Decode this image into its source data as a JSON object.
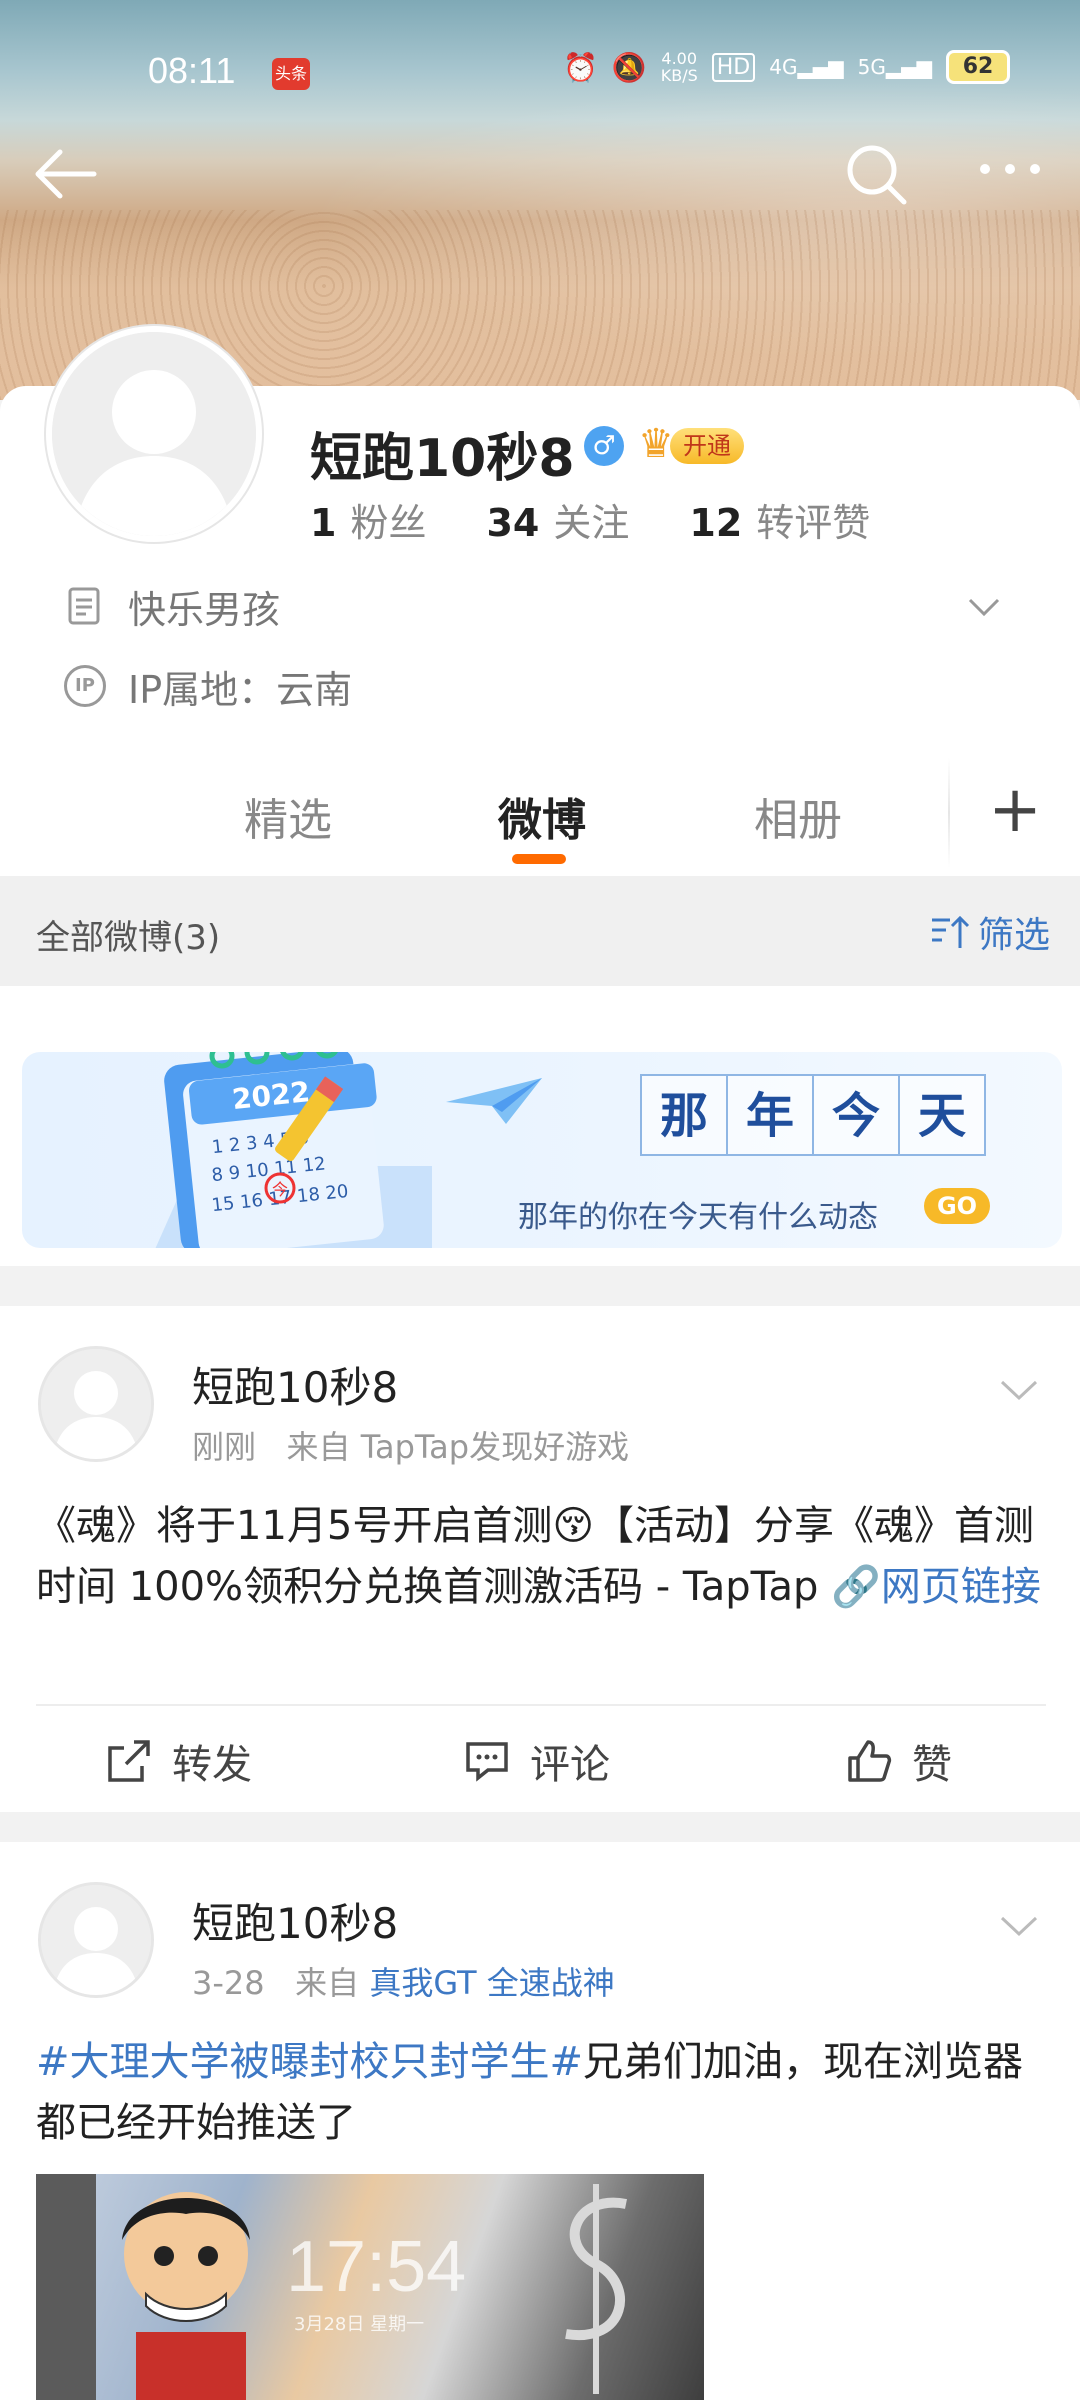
{
  "status_bar": {
    "time": "08:11",
    "news_badge": "头条",
    "net_speed_value": "4.00",
    "net_speed_unit": "KB/S",
    "hd_label": "HD",
    "signal1_label": "4G",
    "signal2_label": "5G",
    "battery": "62"
  },
  "profile": {
    "username": "短跑10秒8",
    "gender_symbol": "♂",
    "vip_label": "开通",
    "stats": [
      {
        "count": "1",
        "label": "粉丝"
      },
      {
        "count": "34",
        "label": "关注"
      },
      {
        "count": "12",
        "label": "转评赞"
      }
    ],
    "bio": "快乐男孩",
    "ip_badge": "IP",
    "ip_location": "IP属地：云南"
  },
  "tabs": [
    {
      "label": "精选",
      "active": false
    },
    {
      "label": "微博",
      "active": true
    },
    {
      "label": "相册",
      "active": false
    }
  ],
  "tab_add": "+",
  "filter_bar": {
    "all_label": "全部微博(3)",
    "filter_label": "筛选"
  },
  "memory_banner": {
    "title_chars": [
      "那",
      "年",
      "今",
      "天"
    ],
    "subtitle": "那年的你在今天有什么动态",
    "go_label": "GO",
    "calendar_year": "2022",
    "calendar_badge": "今"
  },
  "posts": [
    {
      "author": "短跑10秒8",
      "time": "刚刚",
      "source_prefix": "来自",
      "source": "TapTap发现好游戏",
      "text": "《魂》将于11月5号开启首测😚【活动】分享《魂》首测时间 100%领积分兑换首测激活码 - TapTap ",
      "link_label": "网页链接",
      "actions": {
        "repost": "转发",
        "comment": "评论",
        "like": "赞"
      }
    },
    {
      "author": "短跑10秒8",
      "time": "3-28",
      "source_prefix": "来自",
      "source": "真我GT 全速战神",
      "hashtag": "#大理大学被曝封校只封学生#",
      "text": "兄弟们加油，现在浏览器都已经开始推送了",
      "image_clock": "17:54",
      "image_date": "3月28日 星期一"
    }
  ],
  "colors": {
    "accent_orange": "#ff6a00",
    "link_blue": "#3d78c4",
    "vip_gold": "#f7b928"
  }
}
